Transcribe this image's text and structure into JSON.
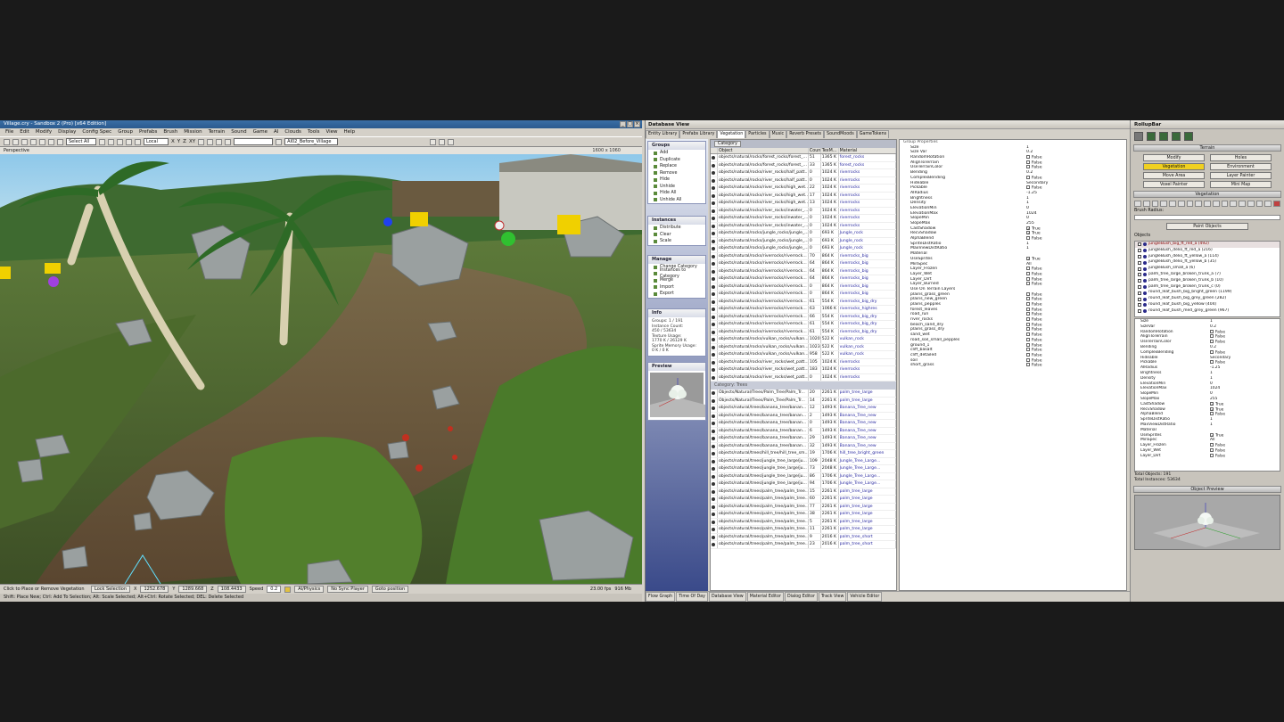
{
  "editor": {
    "title": "Village.cry - Sandbox 2 (Pro) [x64 Edition]",
    "menu": [
      "File",
      "Edit",
      "Modify",
      "Display",
      "Config Spec",
      "Group",
      "Prefabs",
      "Brush",
      "Mission",
      "Terrain",
      "Sound",
      "Game",
      "AI",
      "Clouds",
      "Tools",
      "View",
      "Help"
    ],
    "select_combo": "Select All",
    "coord_combo": "Local",
    "axes": [
      "X",
      "Y",
      "Z",
      "XY"
    ],
    "layer_combo": "AI02_Before_Village",
    "viewport_label": "Perspective",
    "viewport_resolution": "1600 x 1060",
    "status": {
      "hint": "Click to Place or Remove Vegetation",
      "lock_selection": "Lock Selection",
      "x": "1252.678",
      "y": "1289.668",
      "z": "108.4433",
      "speed_label": "Speed",
      "speed": "0.2",
      "ai_physics": "AI/Physics",
      "no_sync": "No Sync Player",
      "goto": "Goto position",
      "fps": "23.00 fps",
      "mem": "916 Mb"
    },
    "keyhint": "Shift: Place New; Ctrl: Add To Selection; Alt: Scale Selected; Alt+Ctrl: Rotate Selected; DEL: Delete Selected"
  },
  "database": {
    "title": "Database View",
    "tabs": [
      "Entity Library",
      "Prefabs Library",
      "Vegetation",
      "Particles",
      "Music",
      "Reverb Presets",
      "SoundMoods",
      "GameTokens"
    ],
    "active_tab": "Vegetation",
    "groups": {
      "title": "Groups",
      "items": [
        "Add",
        "Duplicate",
        "Replace",
        "Remove",
        "Hide",
        "Unhide",
        "Hide All",
        "Unhide All"
      ]
    },
    "instances": {
      "title": "Instances",
      "items": [
        "Distribute",
        "Clear",
        "Scale"
      ]
    },
    "manage": {
      "title": "Manage",
      "items": [
        "Change Category",
        "Instances to Category",
        "Merge",
        "Import",
        "Export"
      ]
    },
    "info": {
      "title": "Info",
      "lines": [
        "Groups: 1 / 191",
        "Instance Count:",
        "450 / 53634",
        "Texture Usage:",
        "1770 K / 26129 K",
        "Sprite Memory Usage:",
        "0 K / 0 K"
      ]
    },
    "preview": {
      "title": "Preview"
    },
    "category_label": "Category",
    "columns": [
      "Object",
      "Count",
      "TexM...",
      "Material"
    ],
    "rows_rocks": [
      [
        "objects/natural/rocks/forest_rocks/forest_...",
        "51",
        "1365 K",
        "forest_rocks"
      ],
      [
        "objects/natural/rocks/forest_rocks/forest_...",
        "33",
        "1365 K",
        "forest_rocks"
      ],
      [
        "objects/natural/rocks/river_rocks/half_patt...",
        "0",
        "1024 K",
        "riverrocks"
      ],
      [
        "objects/natural/rocks/river_rocks/half_patt...",
        "0",
        "1024 K",
        "riverrocks"
      ],
      [
        "objects/natural/rocks/river_rocks/high_wet...",
        "22",
        "1024 K",
        "riverrocks"
      ],
      [
        "objects/natural/rocks/river_rocks/high_wet...",
        "17",
        "1024 K",
        "riverrocks"
      ],
      [
        "objects/natural/rocks/river_rocks/high_wet...",
        "13",
        "1024 K",
        "riverrocks"
      ],
      [
        "objects/natural/rocks/river_rocks/inwater_...",
        "0",
        "1024 K",
        "riverrocks"
      ],
      [
        "objects/natural/rocks/river_rocks/inwater_...",
        "0",
        "1024 K",
        "riverrocks"
      ],
      [
        "objects/natural/rocks/river_rocks/inwater_...",
        "0",
        "1024 K",
        "riverrocks"
      ],
      [
        "objects/natural/rocks/jungle_rocks/jungle_...",
        "0",
        "693 K",
        "Jungle_rock"
      ],
      [
        "objects/natural/rocks/jungle_rocks/jungle_...",
        "0",
        "693 K",
        "Jungle_rock"
      ],
      [
        "objects/natural/rocks/jungle_rocks/jungle_...",
        "0",
        "693 K",
        "Jungle_rock"
      ],
      [
        "objects/natural/rocks/riverrocks/riverrock...",
        "70",
        "864 K",
        "riverrocks_big"
      ],
      [
        "objects/natural/rocks/riverrocks/riverrock...",
        "64",
        "864 K",
        "riverrocks_big"
      ],
      [
        "objects/natural/rocks/riverrocks/riverrock...",
        "64",
        "864 K",
        "riverrocks_big"
      ],
      [
        "objects/natural/rocks/riverrocks/riverrock...",
        "64",
        "864 K",
        "riverrocks_big"
      ],
      [
        "objects/natural/rocks/riverrocks/riverrock...",
        "0",
        "864 K",
        "riverrocks_big"
      ],
      [
        "objects/natural/rocks/riverrocks/riverrock...",
        "0",
        "864 K",
        "riverrocks_big"
      ],
      [
        "objects/natural/rocks/riverrocks/riverrock...",
        "61",
        "554 K",
        "riverrocks_big_dry"
      ],
      [
        "objects/natural/rocks/riverrocks/riverrock...",
        "63",
        "1066 K",
        "riverrocks_highres"
      ],
      [
        "objects/natural/rocks/riverrocks/riverrock...",
        "66",
        "554 K",
        "riverrocks_big_dry"
      ],
      [
        "objects/natural/rocks/riverrocks/riverrock...",
        "61",
        "554 K",
        "riverrocks_big_dry"
      ],
      [
        "objects/natural/rocks/riverrocks/riverrock...",
        "61",
        "554 K",
        "riverrocks_big_dry"
      ],
      [
        "objects/natural/rocks/vulkan_rocks/vulkan...",
        "1020",
        "522 K",
        "vulkan_rock"
      ],
      [
        "objects/natural/rocks/vulkan_rocks/vulkan...",
        "1023",
        "522 K",
        "vulkan_rock"
      ],
      [
        "objects/natural/rocks/vulkan_rocks/vulkan...",
        "958",
        "522 K",
        "vulkan_rock"
      ],
      [
        "objects/natural/rocks/river_rocks/wet_patt...",
        "105",
        "1024 K",
        "riverrocks"
      ],
      [
        "objects/natural/rocks/river_rocks/wet_patt...",
        "183",
        "1024 K",
        "riverrocks"
      ],
      [
        "objects/natural/rocks/river_rocks/wet_patt...",
        "0",
        "1024 K",
        "riverrocks"
      ]
    ],
    "trees_category": "Category: Trees",
    "rows_trees": [
      [
        "Objects/Natural/Trees/Palm_Tree/Palm_Tr...",
        "20",
        "2261 K",
        "palm_tree_large"
      ],
      [
        "Objects/Natural/Trees/Palm_Tree/Palm_Tr...",
        "14",
        "2261 K",
        "palm_tree_large"
      ],
      [
        "objects/natural/trees/banana_tree/banan...",
        "12",
        "1493 K",
        "Banana_Tree_new"
      ],
      [
        "objects/natural/trees/banana_tree/banan...",
        "2",
        "1493 K",
        "Banana_Tree_new"
      ],
      [
        "objects/natural/trees/banana_tree/banan...",
        "0",
        "1493 K",
        "Banana_Tree_new"
      ],
      [
        "objects/natural/trees/banana_tree/banan...",
        "6",
        "1493 K",
        "Banana_Tree_new"
      ],
      [
        "objects/natural/trees/banana_tree/banan...",
        "29",
        "1493 K",
        "Banana_Tree_new"
      ],
      [
        "objects/natural/trees/banana_tree/banan...",
        "32",
        "1493 K",
        "Banana_Tree_new"
      ],
      [
        "objects/natural/trees/hill_tree/hill_tree_sm...",
        "19",
        "1706 K",
        "hill_tree_bright_green"
      ],
      [
        "objects/natural/trees/jungle_tree_large/ju...",
        "109",
        "2048 K",
        "Jungle_Tree_Large..."
      ],
      [
        "objects/natural/trees/jungle_tree_large/ju...",
        "73",
        "2048 K",
        "Jungle_Tree_Large..."
      ],
      [
        "objects/natural/trees/jungle_tree_large/ju...",
        "86",
        "1706 K",
        "Jungle_Tree_Large..."
      ],
      [
        "objects/natural/trees/jungle_tree_large/ju...",
        "94",
        "1706 K",
        "Jungle_Tree_Large..."
      ],
      [
        "objects/natural/trees/palm_tree/palm_tree...",
        "15",
        "2261 K",
        "palm_tree_large"
      ],
      [
        "objects/natural/trees/palm_tree/palm_tree...",
        "60",
        "2261 K",
        "palm_tree_large"
      ],
      [
        "objects/natural/trees/palm_tree/palm_tree...",
        "77",
        "2261 K",
        "palm_tree_large"
      ],
      [
        "objects/natural/trees/palm_tree/palm_tree...",
        "38",
        "2261 K",
        "palm_tree_large"
      ],
      [
        "objects/natural/trees/palm_tree/palm_tree...",
        "5",
        "2261 K",
        "palm_tree_large"
      ],
      [
        "objects/natural/trees/palm_tree/palm_tree...",
        "11",
        "2261 K",
        "palm_tree_large"
      ],
      [
        "objects/natural/trees/palm_tree/palm_tree...",
        "9",
        "2016 K",
        "palm_tree_short"
      ],
      [
        "objects/natural/trees/palm_tree/palm_tree...",
        "23",
        "2016 K",
        "palm_tree_short"
      ]
    ],
    "props_header": "Group Properties",
    "props": [
      [
        "Size",
        "1"
      ],
      [
        "Size Var",
        "0.2"
      ],
      [
        "RandomRotation",
        "False"
      ],
      [
        "AlignToTerrain",
        "False"
      ],
      [
        "UseTerrainColor",
        "False"
      ],
      [
        "Bending",
        "0.2"
      ],
      [
        "ComplexBending",
        "False"
      ],
      [
        "Hideable",
        "Secondary"
      ],
      [
        "Pickable",
        "False"
      ],
      [
        "AIRadius",
        "-1.25"
      ],
      [
        "Brightness",
        "1"
      ],
      [
        "Density",
        "1"
      ],
      [
        "ElevationMin",
        "0"
      ],
      [
        "ElevationMax",
        "1024"
      ],
      [
        "SlopeMin",
        "0"
      ],
      [
        "SlopeMax",
        "255"
      ],
      [
        "CastShadow",
        "True"
      ],
      [
        "RecvShadow",
        "True"
      ],
      [
        "AlphaBlend",
        "False"
      ],
      [
        "SpriteDistRatio",
        "1"
      ],
      [
        "MaxViewDistRatio",
        "1"
      ],
      [
        "Material",
        ""
      ],
      [
        "UseSprites",
        "True"
      ],
      [
        "MinSpec",
        "All"
      ],
      [
        "Layer_Frozen",
        "False"
      ],
      [
        "Layer_Wet",
        "False"
      ],
      [
        "Layer_Dirt",
        "False"
      ],
      [
        "Layer_Burned",
        "False"
      ],
      [
        "Use On Terrain Layers",
        ""
      ],
      [
        "plains_grass_green",
        "False"
      ],
      [
        "plains_new_green",
        "False"
      ],
      [
        "plains_pepples",
        "False"
      ],
      [
        "forest_leaves",
        "False"
      ],
      [
        "road_run",
        "False"
      ],
      [
        "river_rocks",
        "False"
      ],
      [
        "beach_sand_dry",
        "False"
      ],
      [
        "plains_grass_dry",
        "False"
      ],
      [
        "sand_wet",
        "False"
      ],
      [
        "road_soil_small_pepples",
        "False"
      ],
      [
        "ground_1",
        "False"
      ],
      [
        "cliff_basalt",
        "False"
      ],
      [
        "cliff_detailed",
        "False"
      ],
      [
        "soil",
        "False"
      ],
      [
        "short_grass",
        "False"
      ]
    ],
    "bottom_tabs": [
      "Flow Graph",
      "Time Of Day",
      "Database View",
      "Material Editor",
      "Dialog Editor",
      "Track View",
      "Vehicle Editor"
    ]
  },
  "rollup": {
    "title": "RollupBar",
    "terrain_header": "Terrain",
    "terrain_buttons": [
      "Modify",
      "Holes",
      "Vegetation",
      "Environment",
      "Move Area",
      "Layer Painter",
      "Voxel Painter",
      "Mini Map"
    ],
    "active_button": "Vegetation",
    "vegetation_header": "Vegetation",
    "brush_radius_label": "Brush Radius:",
    "paint_button": "Paint Objects",
    "objects_label": "Objects",
    "objects": [
      "jungleBush_big_ft_red_a (492)",
      "jungleBush_delio_ft_red_a (216)",
      "jungleBush_delio_ft_yellow_a (114)",
      "jungleBush_delio_ft_yellow_b (35)",
      "jungleBush_small_a (6)",
      "palm_tree_large_broken_trunk_a (7)",
      "palm_tree_large_broken_trunk_b (10)",
      "palm_tree_large_broken_trunk_c (0)",
      "round_leaf_bush_big_bright_green (1199)",
      "round_leaf_bush_big_grey_green (282)",
      "round_leaf_bush_big_yellow (404)",
      "round_leaf_bush_med_grey_green (967)"
    ],
    "props": [
      [
        "Size",
        "1"
      ],
      [
        "SizeVar",
        "0.2"
      ],
      [
        "RandomRotation",
        "False"
      ],
      [
        "AlignToTerrain",
        "False"
      ],
      [
        "UseTerrainColor",
        "False"
      ],
      [
        "Bending",
        "0.2"
      ],
      [
        "ComplexBending",
        "False"
      ],
      [
        "Hideable",
        "Secondary"
      ],
      [
        "Pickable",
        "False"
      ],
      [
        "AIRadius",
        "-1.25"
      ],
      [
        "Brightness",
        "1"
      ],
      [
        "Density",
        "1"
      ],
      [
        "ElevationMin",
        "0"
      ],
      [
        "ElevationMax",
        "1024"
      ],
      [
        "SlopeMin",
        "0"
      ],
      [
        "SlopeMax",
        "255"
      ],
      [
        "CastShadow",
        "True"
      ],
      [
        "RecvShadow",
        "True"
      ],
      [
        "AlphaBlend",
        "False"
      ],
      [
        "SpriteDistRatio",
        "1"
      ],
      [
        "MaxViewDistRatio",
        "1"
      ],
      [
        "Material",
        ""
      ],
      [
        "UseSprites",
        "True"
      ],
      [
        "MinSpec",
        "All"
      ],
      [
        "Layer_Frozen",
        "False"
      ],
      [
        "Layer_Wet",
        "False"
      ],
      [
        "Layer_Dirt",
        "False"
      ]
    ],
    "total_objects": "Total Objects: 191",
    "total_instances": "Total Instances: 53634",
    "preview_header": "Object Preview"
  }
}
